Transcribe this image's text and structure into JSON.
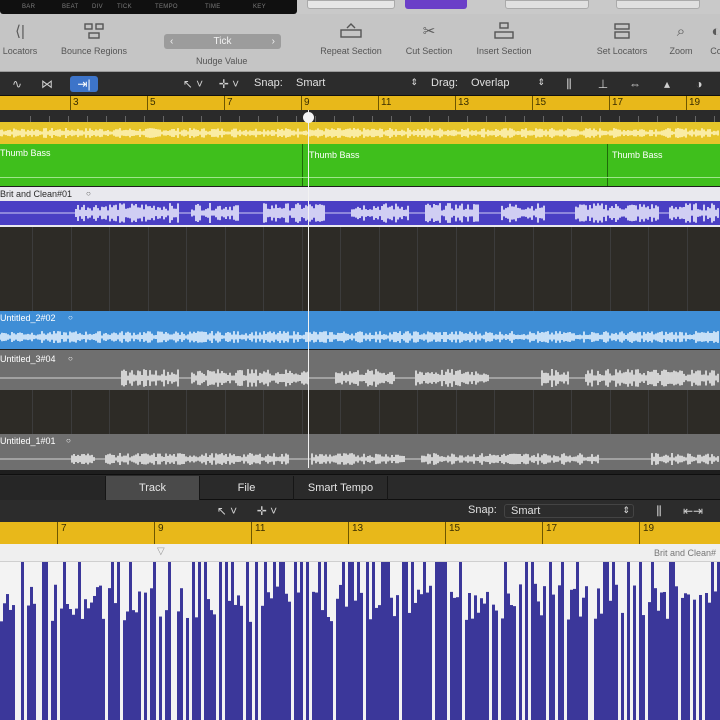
{
  "lcd": {
    "labels": [
      "BAR",
      "BEAT",
      "DIV",
      "TICK",
      "TEMPO",
      "TIME",
      "KEY"
    ]
  },
  "control_bar": {
    "locators_label": "Locators",
    "bounce_label": "Bounce Regions",
    "nudge_value": "Tick",
    "nudge_label": "Nudge Value",
    "repeat_label": "Repeat Section",
    "cut_label": "Cut Section",
    "insert_label": "Insert Section",
    "set_locators_label": "Set Locators",
    "zoom_label": "Zoom",
    "colors_label": "Co"
  },
  "toolbar": {
    "snap_label": "Snap:",
    "snap_value": "Smart",
    "drag_label": "Drag:",
    "drag_value": "Overlap"
  },
  "ruler": {
    "bars": [
      "3",
      "5",
      "7",
      "9",
      "11",
      "13",
      "15",
      "17",
      "19"
    ]
  },
  "tracks": {
    "track1_region": "Thumb Bass",
    "track1_region_b": "Thumb Bass",
    "track1_region_c": "Thumb Bass",
    "track2_region": "Brit and Clean#01",
    "track3_region": "Untitled_2#02",
    "track4_region": "Untitled_3#04",
    "track5_region": "Untitled_1#01"
  },
  "editor": {
    "tab_track": "Track",
    "tab_file": "File",
    "tab_smart_tempo": "Smart Tempo",
    "snap_label": "Snap:",
    "snap_value": "Smart",
    "ruler_bars": [
      "7",
      "9",
      "11",
      "13",
      "15",
      "17",
      "19"
    ],
    "region_name": "Brit and Clean#"
  },
  "colors": {
    "ruler": "#e8b81a",
    "green": "#3fbf1c",
    "purple": "#4a3fc4",
    "blue": "#3f8ed6",
    "grey_track": "#6f6f6f",
    "dark_track": "#2d2b26"
  }
}
